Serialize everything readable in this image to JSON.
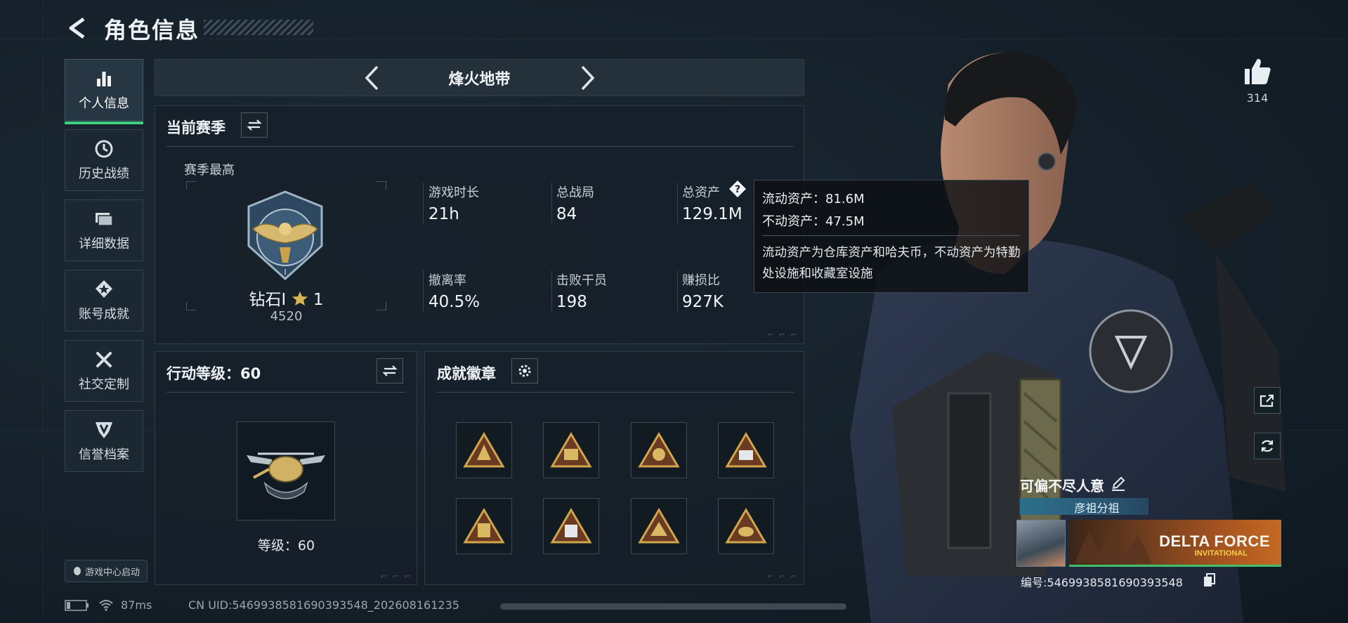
{
  "header": {
    "title": "角色信息"
  },
  "sidebar": {
    "items": [
      {
        "label": "个人信息",
        "icon": "bar-chart-icon",
        "active": true
      },
      {
        "label": "历史战绩",
        "icon": "clock-icon"
      },
      {
        "label": "详细数据",
        "icon": "folder-icon"
      },
      {
        "label": "账号成就",
        "icon": "star-badge-icon"
      },
      {
        "label": "社交定制",
        "icon": "tools-icon"
      },
      {
        "label": "信誉档案",
        "icon": "shield-logo-icon"
      }
    ],
    "game_center": "游戏中心启动"
  },
  "mode_selector": {
    "title": "烽火地带"
  },
  "season": {
    "title": "当前赛季",
    "subtitle": "赛季最高",
    "rank_name": "钻石Ⅰ",
    "rank_stars": "1",
    "rank_score": "4520",
    "stats": [
      {
        "label": "游戏时长",
        "value": "21h"
      },
      {
        "label": "总战局",
        "value": "84"
      },
      {
        "label": "总资产",
        "value": "129.1M"
      },
      {
        "label": "撤离率",
        "value": "40.5%"
      },
      {
        "label": "击败干员",
        "value": "198"
      },
      {
        "label": "赚损比",
        "value": "927K"
      }
    ]
  },
  "tooltip": {
    "liquid": "流动资产：81.6M",
    "fixed": "不动资产：47.5M",
    "description": "流动资产为仓库资产和哈夫币，不动资产为特勤处设施和收藏室设施"
  },
  "action_level": {
    "title": "行动等级：60",
    "level_text": "等级：60"
  },
  "medals": {
    "title": "成就徽章",
    "items": [
      "medal-1",
      "medal-2",
      "medal-3",
      "medal-4",
      "medal-5",
      "medal-6",
      "medal-7",
      "medal-8"
    ]
  },
  "social": {
    "likes": "314"
  },
  "player": {
    "name": "可偏不尽人意",
    "clan": "彦祖分祖",
    "banner_title": "DELTA FORCE",
    "banner_sub": "INVITATIONAL",
    "id_text": "编号:5469938581690393548"
  },
  "status": {
    "ping": "87ms",
    "uid": "CN UID:5469938581690393548_202608161235"
  },
  "colors": {
    "accent_green": "#3fd17f",
    "gold": "#c9a24a",
    "panel_bg": "#16202a"
  }
}
